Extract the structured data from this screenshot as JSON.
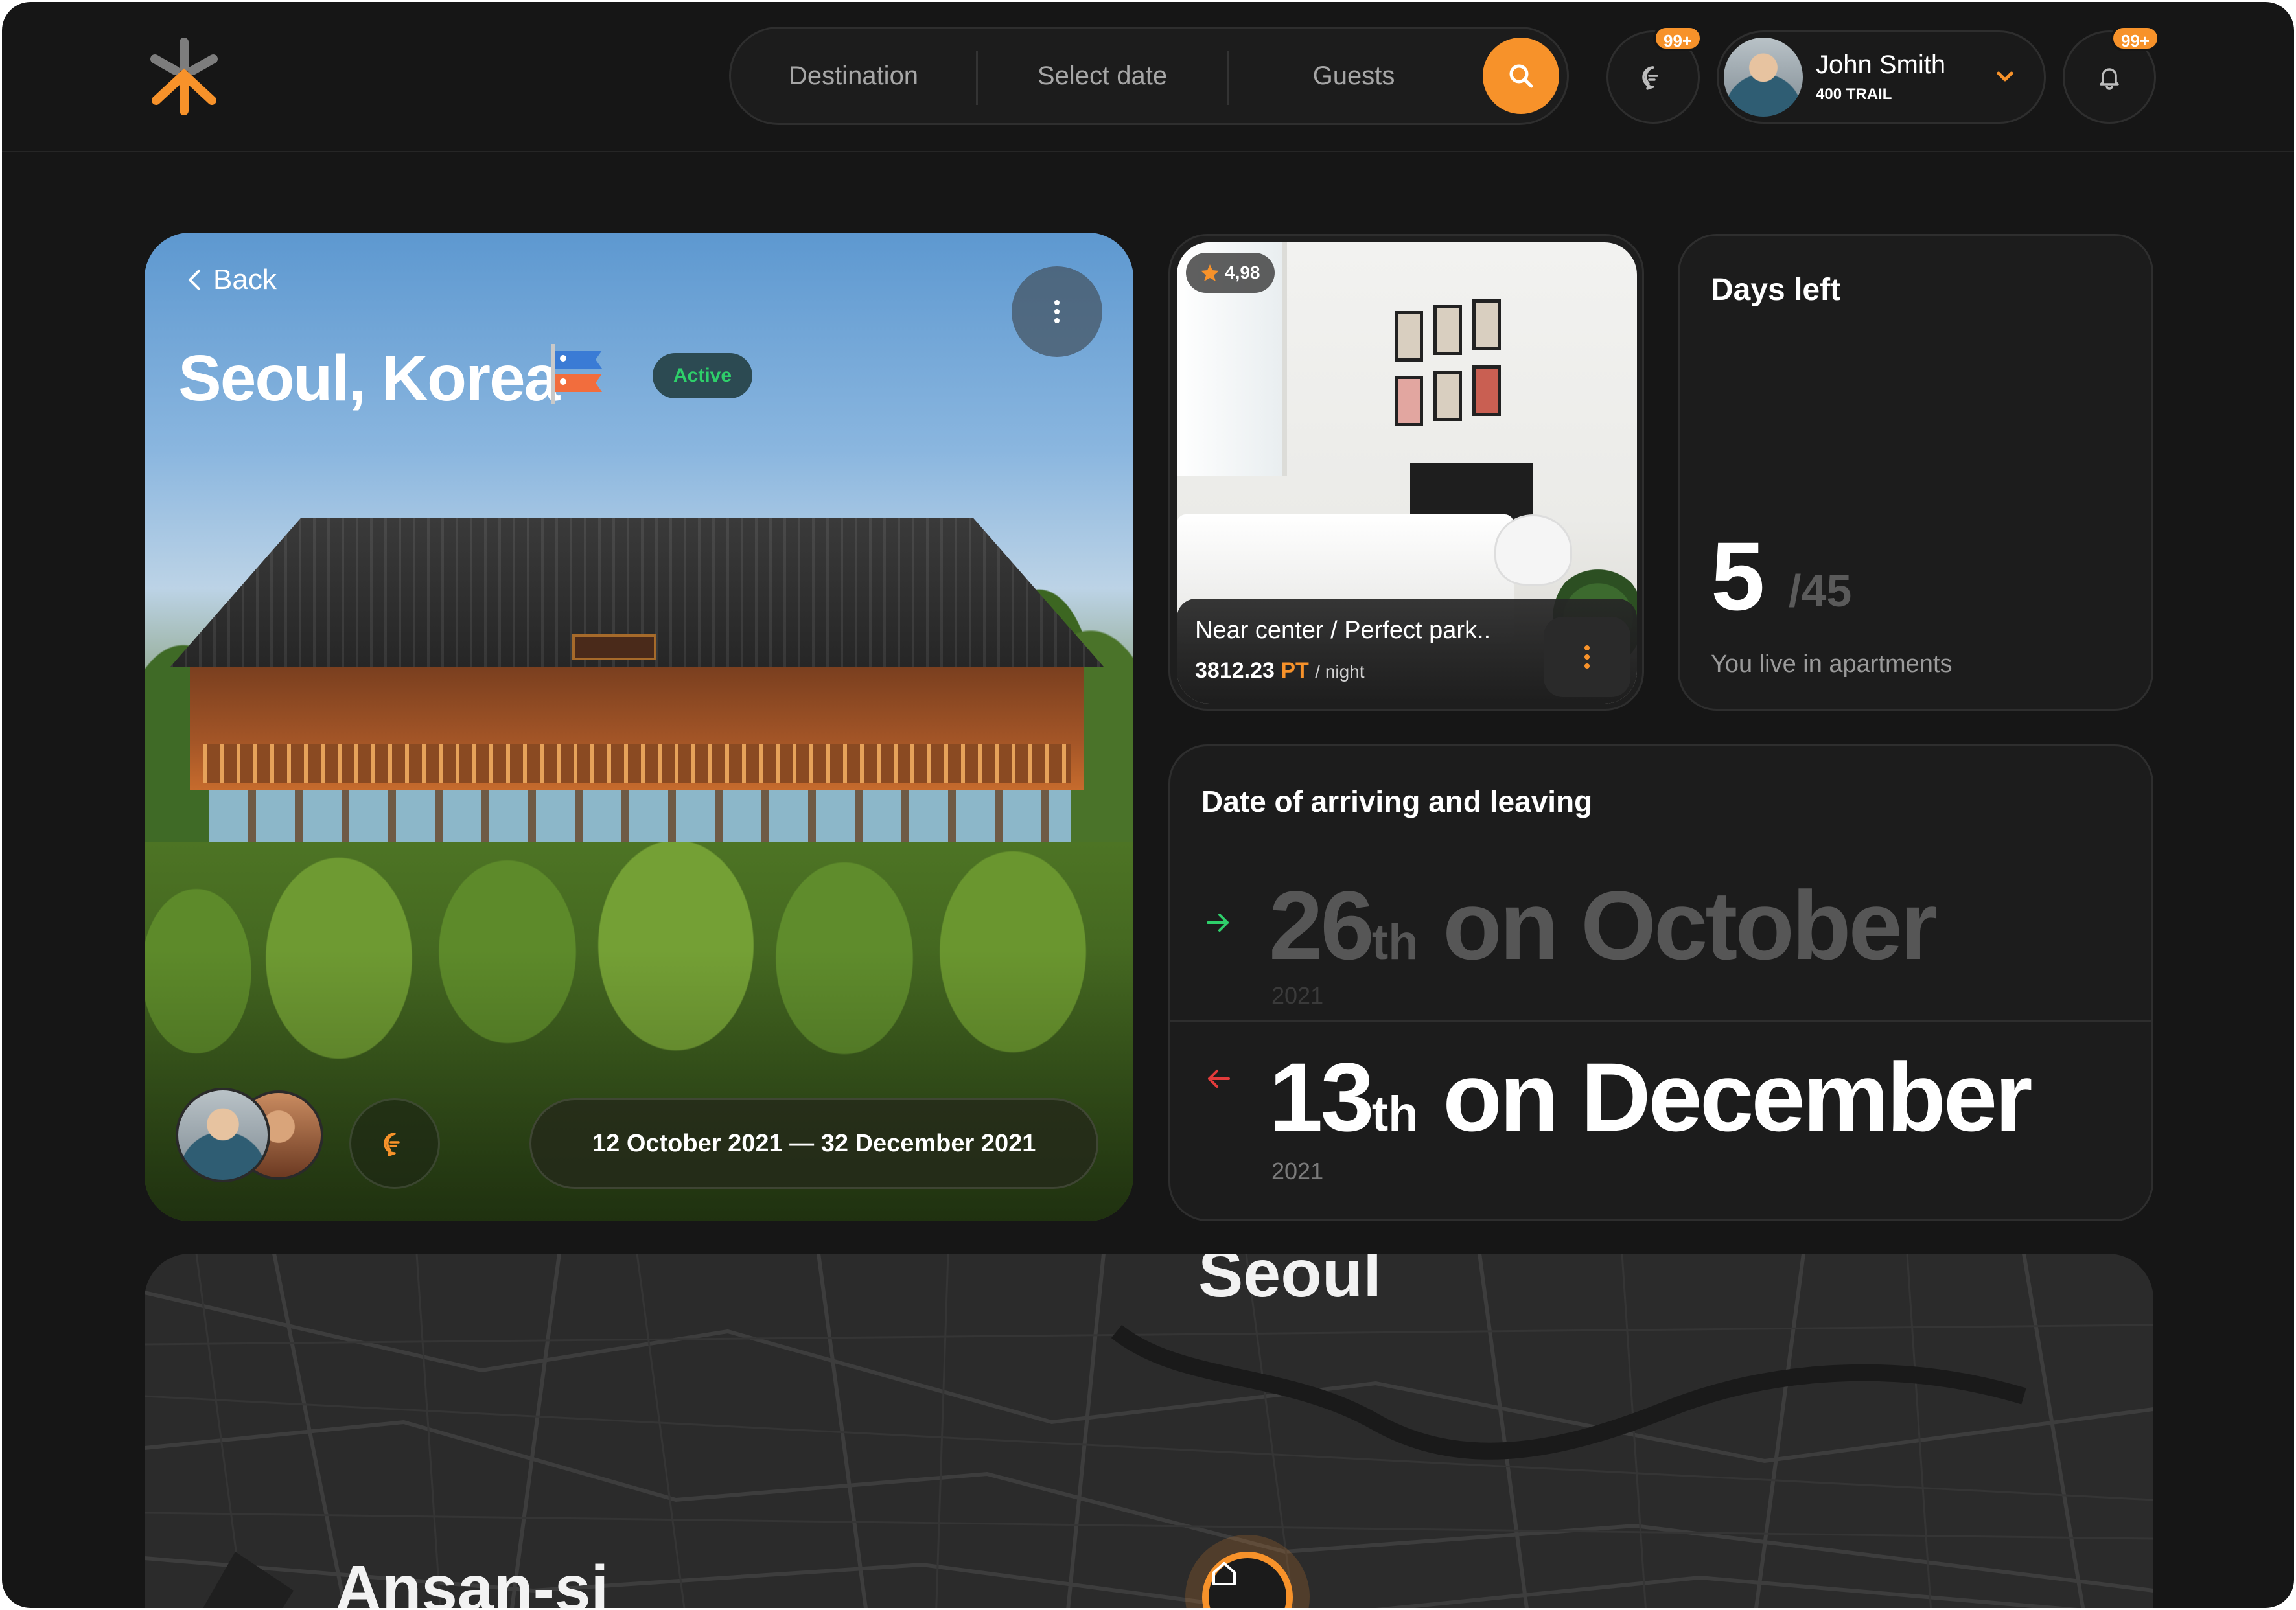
{
  "header": {
    "search": {
      "destination": "Destination",
      "date": "Select date",
      "guests": "Guests"
    },
    "messages_badge": "99+",
    "notifications_badge": "99+",
    "user": {
      "name": "John Smith",
      "tier": "400 TRAIL"
    }
  },
  "trip": {
    "back": "Back",
    "title": "Seoul, Korea",
    "status": "Active",
    "date_range": "12 October  2021 — 32 December  2021"
  },
  "apartment": {
    "rating": "4,98",
    "title": "Near center / Perfect park..",
    "price": "3812.23",
    "currency": "PT",
    "per": "/ night"
  },
  "days_left": {
    "heading": "Days left",
    "value": "5",
    "total": "/45",
    "caption": "You live in apartments"
  },
  "stay_dates": {
    "heading": "Date of arriving and leaving",
    "arrive": {
      "day": "26",
      "ordinal": "th",
      "month_text": " on October",
      "year": "2021"
    },
    "leave": {
      "day": "13",
      "ordinal": "th",
      "month_text": " on December",
      "year": "2021"
    }
  },
  "map": {
    "labels": [
      "Seoul",
      "Ansan-si"
    ]
  },
  "colors": {
    "accent": "#f7922a",
    "active": "#2ecf6a",
    "arrive_arrow": "#2ecf6a",
    "leave_arrow": "#e23b3b",
    "background": "#161616"
  },
  "icons": [
    "logo-icon",
    "search-icon",
    "chat-icon",
    "chevron-down-icon",
    "bell-icon",
    "chevron-left-icon",
    "more-vertical-icon",
    "star-icon",
    "arrow-right-icon",
    "arrow-left-icon",
    "home-icon"
  ]
}
